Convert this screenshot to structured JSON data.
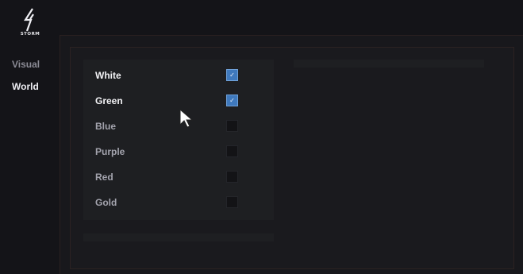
{
  "app": {
    "logo_text": "STORM"
  },
  "sidebar": {
    "items": [
      {
        "label": "Visual",
        "active": false
      },
      {
        "label": "World",
        "active": true
      }
    ]
  },
  "color_filter": {
    "items": [
      {
        "label": "White",
        "checked": true
      },
      {
        "label": "Green",
        "checked": true
      },
      {
        "label": "Blue",
        "checked": false
      },
      {
        "label": "Purple",
        "checked": false
      },
      {
        "label": "Red",
        "checked": false
      },
      {
        "label": "Gold",
        "checked": false
      }
    ]
  },
  "colors": {
    "accent": "#3f79bd",
    "background": "#141418",
    "panel": "#1e1f22"
  },
  "icons": {
    "logo": "lightning-bolt-icon",
    "check": "checkmark-icon",
    "cursor": "mouse-pointer-icon"
  }
}
